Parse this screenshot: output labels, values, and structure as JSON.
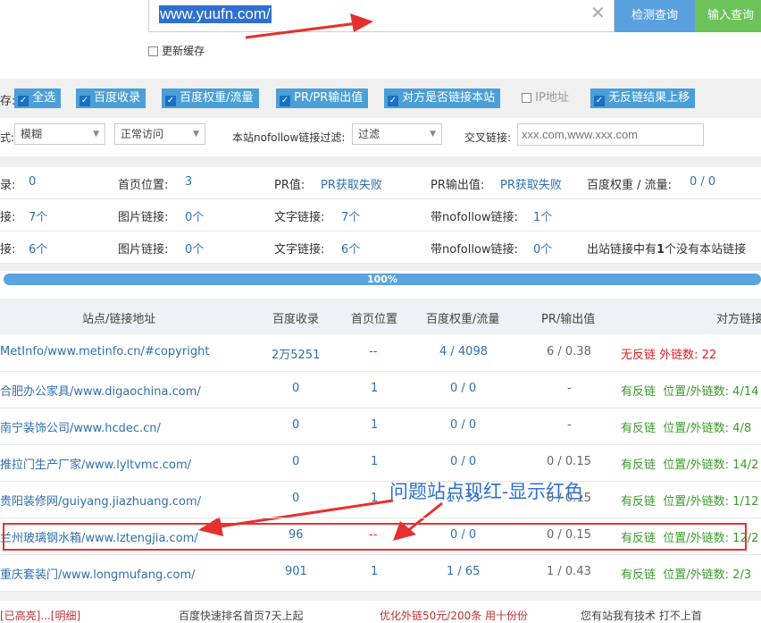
{
  "search": {
    "url": "www.yuufn.com/",
    "clear_glyph": "✕",
    "check_button": "检测查询",
    "input_button": "输入查询",
    "refresh_cache": "更新缓存"
  },
  "options": {
    "prefix": "存:",
    "items": [
      {
        "label": "全选",
        "checked": true
      },
      {
        "label": "百度收录",
        "checked": true
      },
      {
        "label": "百度权重/流量",
        "checked": true
      },
      {
        "label": "PR/PR输出值",
        "checked": true
      },
      {
        "label": "对方是否链接本站",
        "checked": true
      },
      {
        "label": "IP地址",
        "checked": false
      },
      {
        "label": "无反链结果上移",
        "checked": true
      }
    ]
  },
  "filters": {
    "prefix": "式:",
    "mode": "模糊",
    "access": "正常访问",
    "nofollow_label": "本站nofollow链接过滤:",
    "nofollow_value": "过滤",
    "cross_label": "交叉链接:",
    "cross_placeholder": "xxx.com,www.xxx.com"
  },
  "stats": {
    "row1": {
      "a_label": "录:",
      "a_value": "0",
      "b_label": "首页位置:",
      "b_value": "3",
      "c_label": "PR值:",
      "c_value": "PR获取失败",
      "d_label": "PR输出值:",
      "d_value": "PR获取失败",
      "e_label": "百度权重 / 流量:",
      "e_value": "0 / 0"
    },
    "row2": {
      "a_label": "接:",
      "a_value": "7个",
      "b_label": "图片链接:",
      "b_value": "0个",
      "c_label": "文字链接:",
      "c_value": "7个",
      "d_label": "带nofollow链接:",
      "d_value": "1个"
    },
    "row3": {
      "a_label": "接:",
      "a_value": "6个",
      "b_label": "图片链接:",
      "b_value": "0个",
      "c_label": "文字链接:",
      "c_value": "6个",
      "d_label": "带nofollow链接:",
      "d_value": "0个",
      "note_pre": "出站链接中有",
      "note_num": "1",
      "note_post": "个没有本站链接"
    }
  },
  "progress": {
    "label": "100%",
    "value": 100
  },
  "table": {
    "headers": [
      "站点/链接地址",
      "百度收录",
      "首页位置",
      "百度权重/流量",
      "PR/输出值",
      "对方链接"
    ],
    "rows": [
      {
        "site": "MetInfo/www.metinfo.cn/#copyright",
        "index": "2万5251",
        "home": "--",
        "weight": "4 / 4098",
        "pr": "6 / 0.38",
        "status": "无反链",
        "ext": "外链数: 22",
        "bad": true
      },
      {
        "site": "合肥办公家具/www.digaochina.com/",
        "index": "0",
        "home": "1",
        "weight": "0 / 0",
        "pr": "-",
        "status": "有反链",
        "ext": "位置/外链数: 4/14",
        "bad": false
      },
      {
        "site": "南宁装饰公司/www.hcdec.cn/",
        "index": "0",
        "home": "1",
        "weight": "0 / 0",
        "pr": "-",
        "status": "有反链",
        "ext": "位置/外链数: 4/8",
        "bad": false
      },
      {
        "site": "推拉门生产厂家/www.lyltvmc.com/",
        "index": "0",
        "home": "1",
        "weight": "0 / 0",
        "pr": "0 / 0.15",
        "status": "有反链",
        "ext": "位置/外链数: 14/2",
        "bad": false
      },
      {
        "site": "贵阳装修网/guiyang.jiazhuang.com/",
        "index": "0",
        "home": "1",
        "weight": "1 / 33",
        "pr": "0 / 0.15",
        "status": "有反链",
        "ext": "位置/外链数: 1/12",
        "bad": false
      },
      {
        "site": "兰州玻璃钢水箱/www.lztengjia.com/",
        "index": "96",
        "home": "--",
        "weight": "0 / 0",
        "pr": "0 / 0.15",
        "status": "有反链",
        "ext": "位置/外链数: 12/2",
        "bad": false
      },
      {
        "site": "重庆套装门/www.longmufang.com/",
        "index": "901",
        "home": "1",
        "weight": "1 / 65",
        "pr": "1 / 0.43",
        "status": "有反链",
        "ext": "位置/外链数: 2/3",
        "bad": false
      }
    ]
  },
  "annotation": "问题站点现红-显示红色",
  "footer": [
    "[已高亮]...[明细]",
    "百度快速排名首页7天上起",
    "优化外链50元/200条 用十份份",
    "您有站我有技术 打不上首"
  ],
  "colors": {
    "accent": "#2e6fd1",
    "check_btn": "#5aa0de",
    "input_btn": "#6cc35a",
    "red": "#e63030",
    "green": "#3a9a2a"
  }
}
